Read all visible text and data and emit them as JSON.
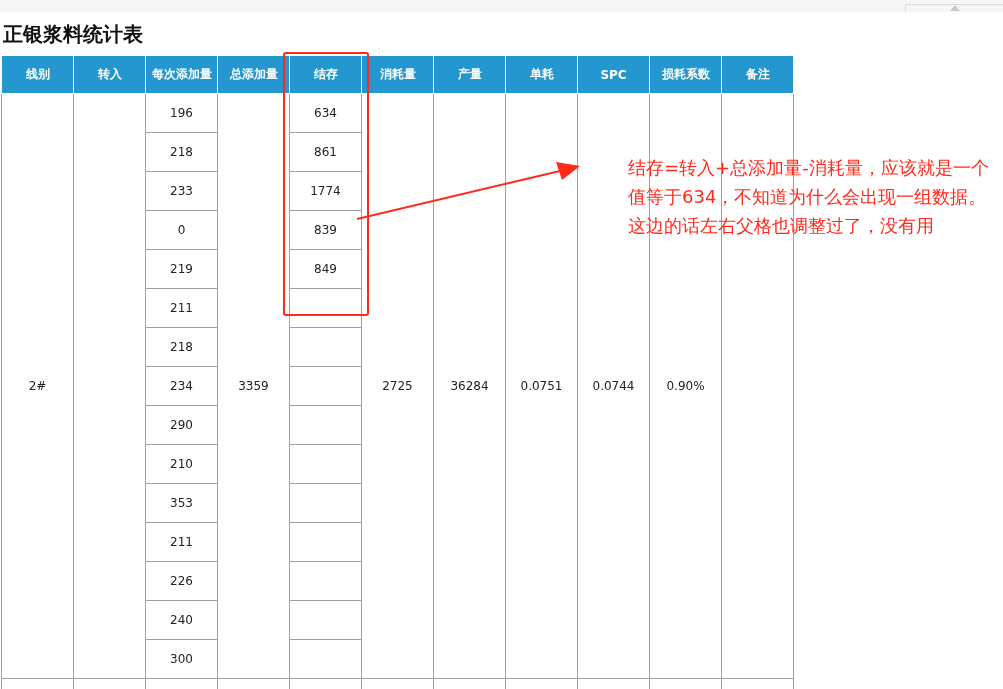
{
  "title": "正银浆料统计表",
  "table": {
    "columns": [
      "线别",
      "转入",
      "每次添加量",
      "总添加量",
      "结存",
      "消耗量",
      "产量",
      "单耗",
      "SPC",
      "损耗系数",
      "备注"
    ],
    "rows": [
      {
        "line": "2#",
        "additions": [
          "196",
          "218",
          "233",
          "0",
          "219",
          "211",
          "218",
          "234",
          "290",
          "210",
          "353",
          "211",
          "226",
          "240",
          "300"
        ],
        "total_addition": "3359",
        "stock": [
          "634",
          "861",
          "1774",
          "839",
          "849"
        ],
        "consumption": "2725",
        "output": "36284",
        "unit_consumption": "0.0751",
        "spc": "0.0744",
        "loss_factor": "0.90%"
      }
    ]
  },
  "annotation": {
    "text": "结存=转入+总添加量-消耗量，应该就是一个值等于634，不知道为什么会出现一组数据。这边的话左右父格也调整过了，没有用"
  }
}
